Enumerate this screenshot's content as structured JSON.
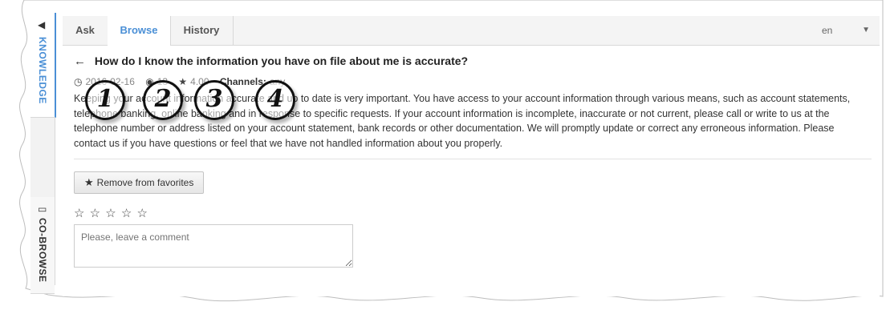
{
  "sidebar": {
    "knowledge_label": "KNOWLEDGE",
    "cobrowse_label": "CO-BROWSE"
  },
  "tabs": {
    "ask": "Ask",
    "browse": "Browse",
    "history": "History"
  },
  "language": {
    "selected": "en"
  },
  "article": {
    "title": "How do I know the information you have on file about me is accurate?",
    "date": "2016-02-16",
    "views": "13",
    "rating": "4.00",
    "channels_label": "Channels:",
    "channels_value": "any",
    "body": "Keeping your account information accurate and up to date is very important. You have access to your account information through various means, such as account statements, telephone banking, online banking and in response to specific requests. If your account information is incomplete, inaccurate or not current, please call or write to us at the telephone number or address listed on your account statement, bank records or other documentation. We will promptly update or correct any erroneous information. Please contact us if you have questions or feel that we have not handled information about you properly."
  },
  "callouts": [
    "1",
    "2",
    "3",
    "4"
  ],
  "actions": {
    "favorite_label": "Remove from favorites"
  },
  "feedback": {
    "stars": [
      "☆",
      "☆",
      "☆",
      "☆",
      "☆"
    ],
    "comment_placeholder": "Please, leave a comment"
  },
  "colors": {
    "accent": "#4a8fd6"
  }
}
